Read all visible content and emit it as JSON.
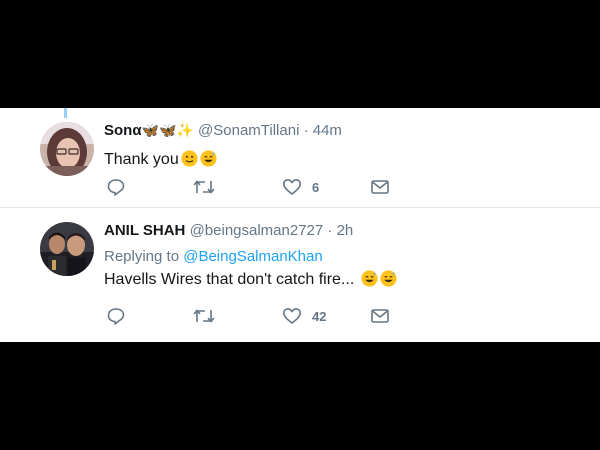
{
  "tweets": [
    {
      "display_name": "Sonα",
      "name_emoji": "🦋🦋✨",
      "handle": "@SonamTillani",
      "separator": "·",
      "time": "44m",
      "text": "Thank you",
      "text_emoji_names": [
        "slight-smile-icon",
        "sweat-smile-icon"
      ],
      "reply_count": "",
      "retweet_count": "",
      "like_count": "6"
    },
    {
      "display_name": "ANIL SHAH",
      "handle": "@beingsalman2727",
      "separator": "·",
      "time": "2h",
      "replying_label": "Replying to",
      "replying_to": "@BeingSalmanKhan",
      "text": "Havells Wires that don't catch fire...",
      "text_emoji_names": [
        "sweat-smile-icon",
        "sweat-smile-icon"
      ],
      "reply_count": "",
      "retweet_count": "",
      "like_count": "42"
    }
  ],
  "colors": {
    "accent": "#1da1f2",
    "secondary_text": "#657786",
    "primary_text": "#14171a",
    "divider": "#e1e8ed",
    "emoji_yellow": "#fcc21b"
  }
}
